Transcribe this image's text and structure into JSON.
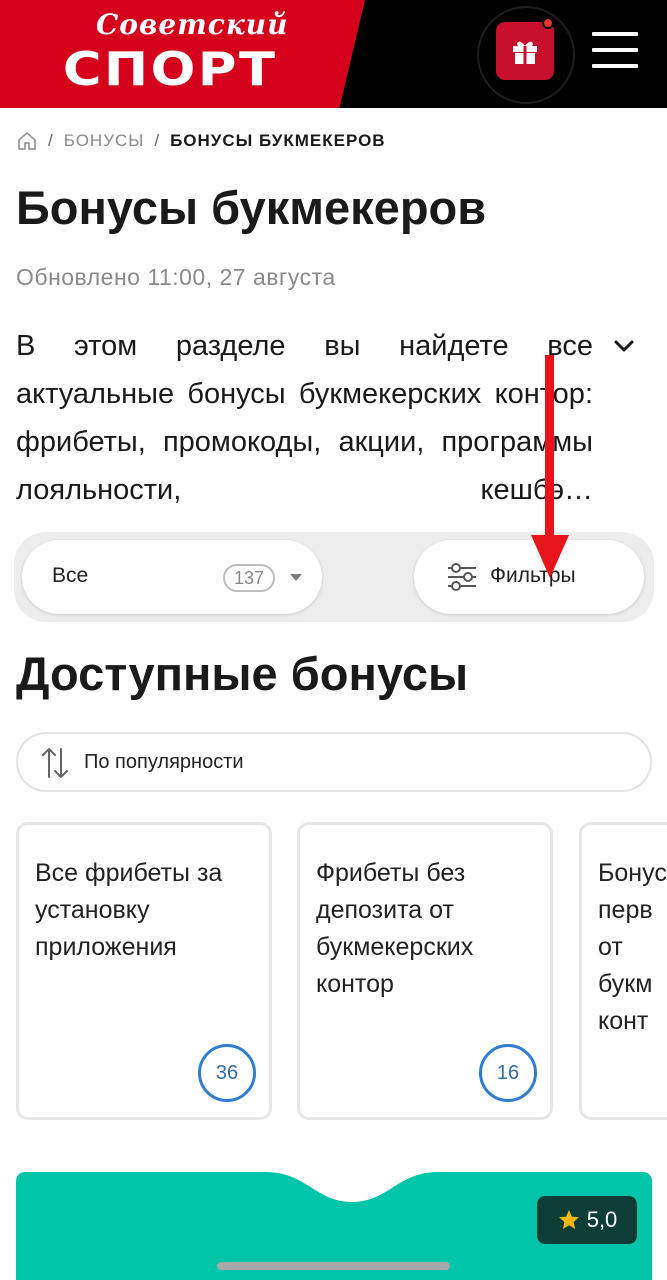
{
  "header": {
    "logo_script": "Советский",
    "logo_main": "СПОРТ",
    "gift_icon": "gift-icon",
    "menu_icon": "hamburger-icon",
    "colors": {
      "brand_red": "#d5001c",
      "header_bg": "#000000"
    }
  },
  "breadcrumb": {
    "home_icon": "home-icon",
    "items": [
      "БОНУСЫ",
      "БОНУСЫ БУКМЕКЕРОВ"
    ],
    "separator": "/"
  },
  "page": {
    "title": "Бонусы букмекеров",
    "updated": "Обновлено 11:00, 27 августа",
    "intro": "В этом разделе вы найдете все актуальные бонусы букмекерских контор: фрибеты, промокоды, акции, программы лояльности, кешбэ…"
  },
  "filter_bar": {
    "select_label": "Все",
    "select_count": "137",
    "filters_label": "Фильтры"
  },
  "section": {
    "title": "Доступные бонусы",
    "sort_label": "По популярности"
  },
  "cards": [
    {
      "title": "Все фрибеты за установку приложения",
      "count": "36"
    },
    {
      "title": "Фрибеты без депозита от букмекерских контор",
      "count": "16"
    },
    {
      "title": "Бонусы перв от букм конт",
      "count": ""
    }
  ],
  "promo": {
    "rating": "5,0",
    "colors": {
      "teal": "#00c5a8",
      "rating_bg": "#0d3d36",
      "star": "#f2b705"
    }
  }
}
